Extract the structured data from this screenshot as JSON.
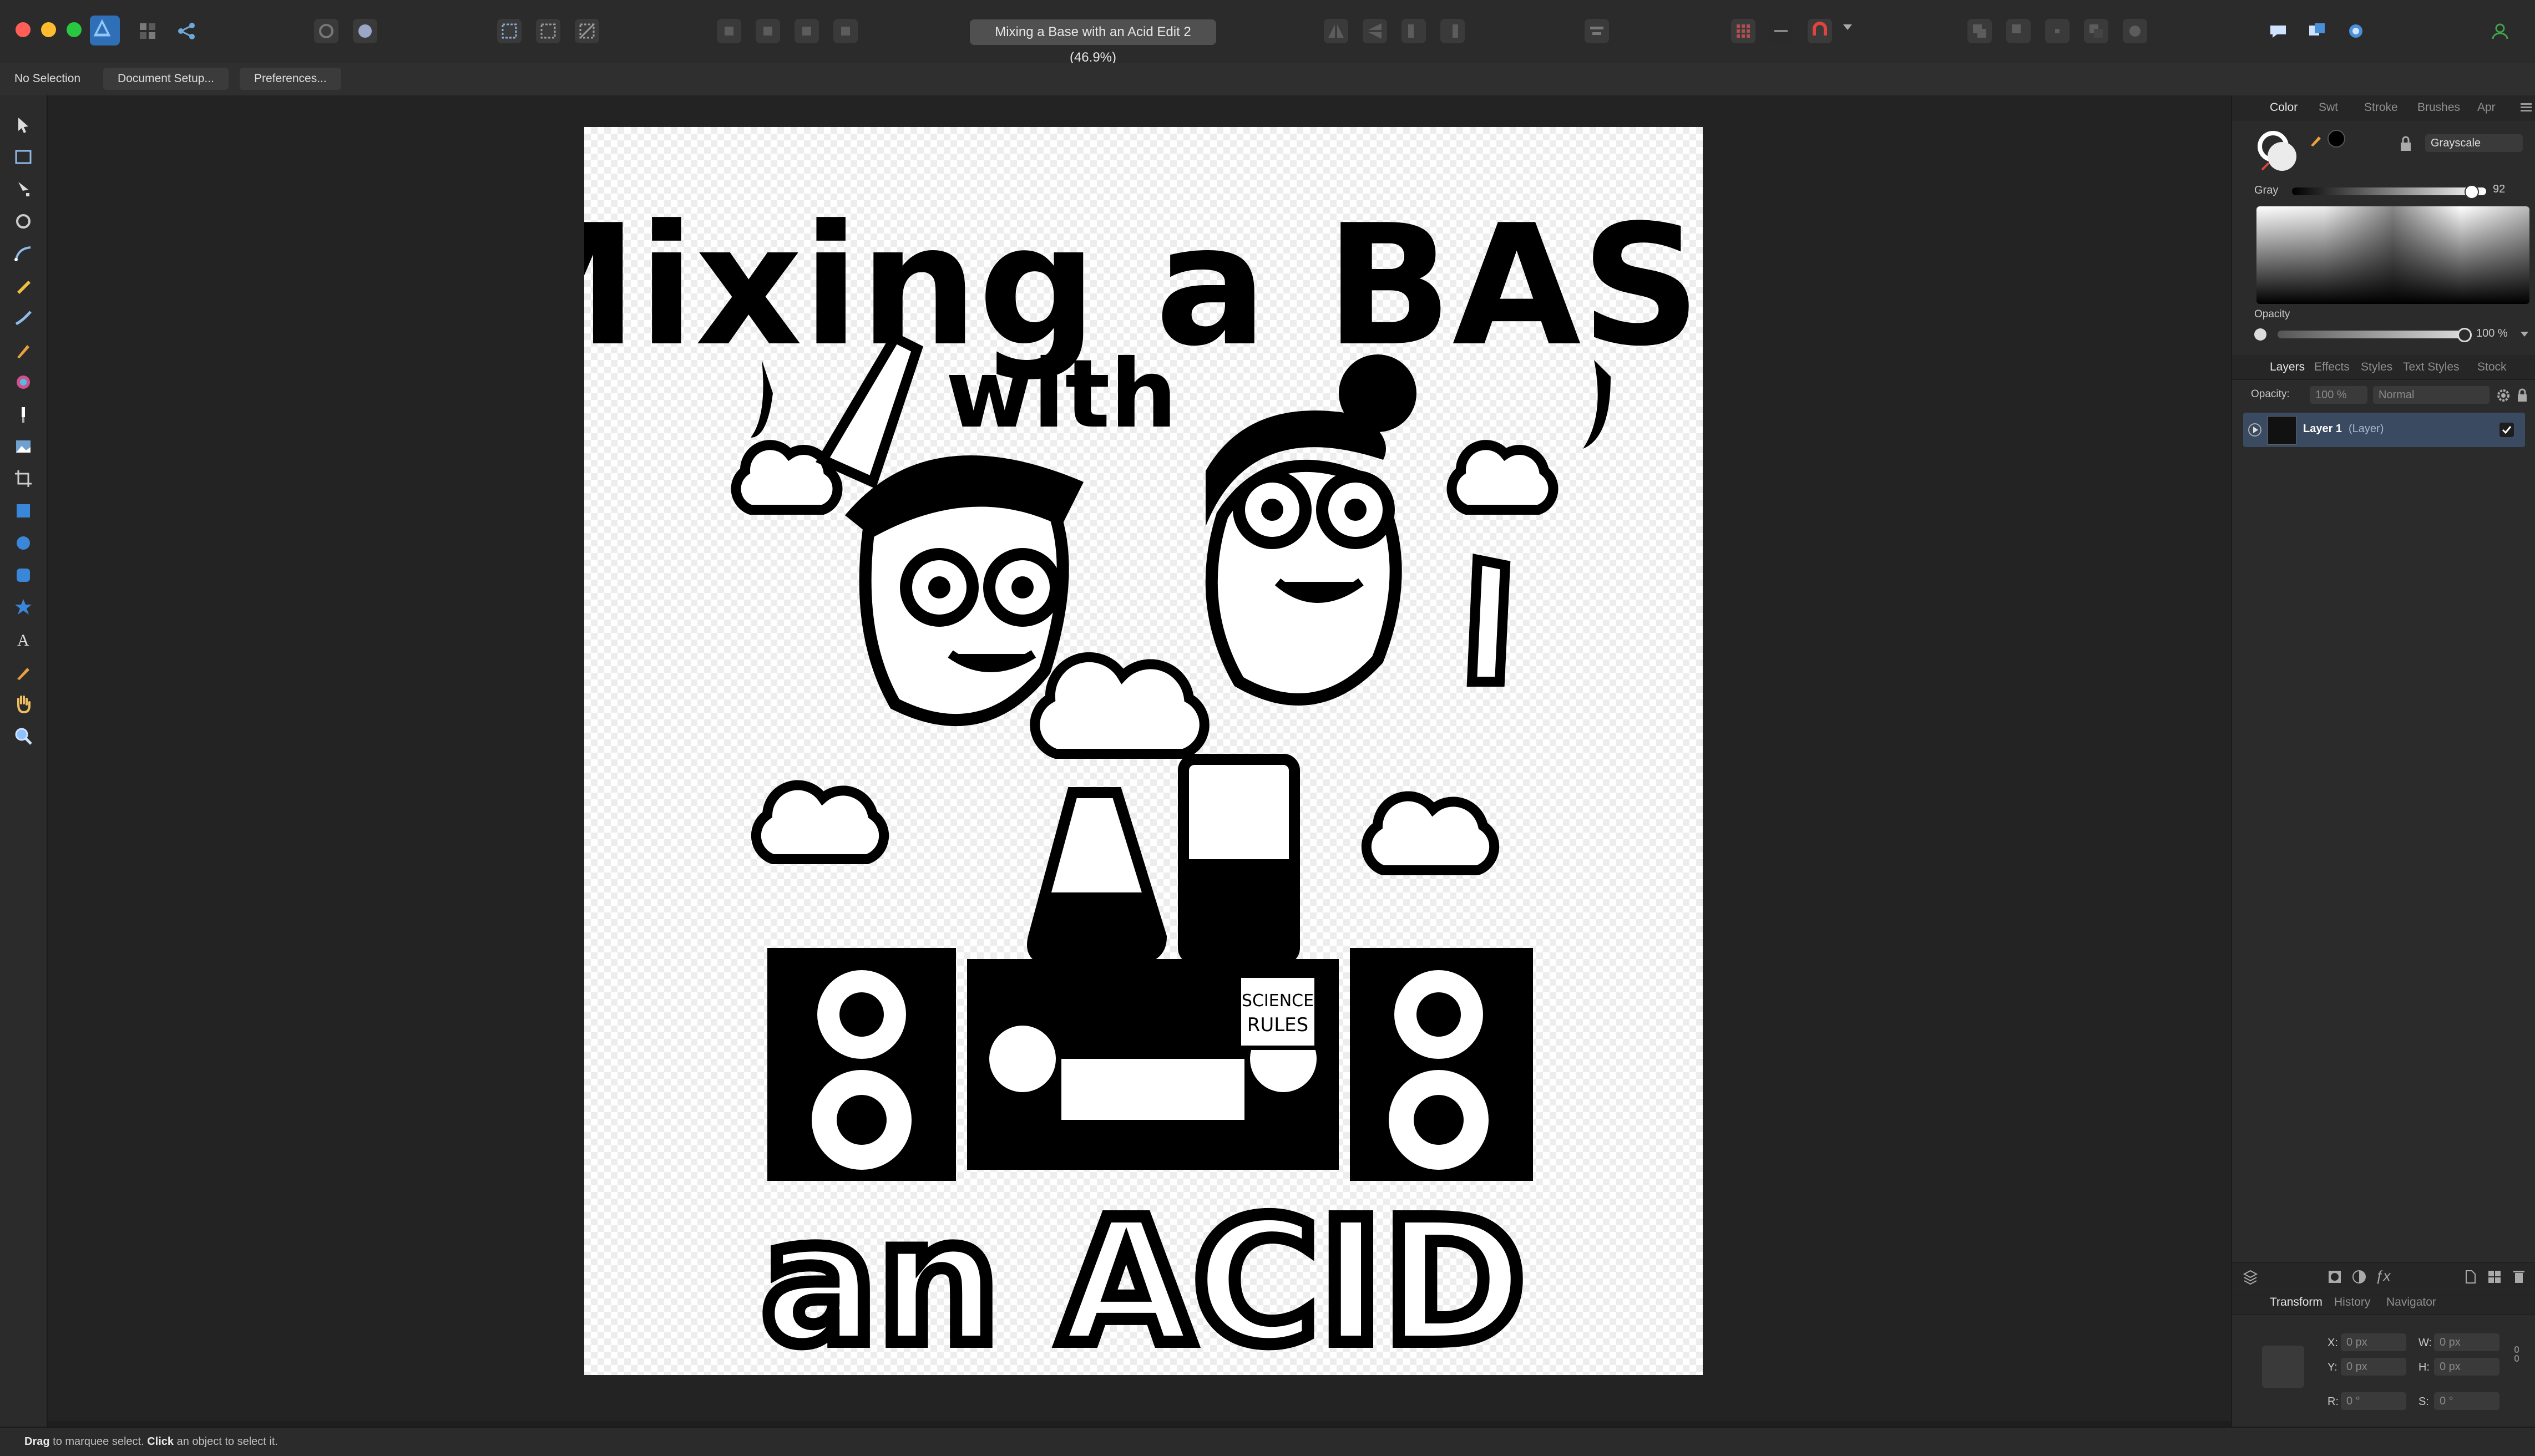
{
  "app": {
    "document_title": "Mixing a Base with an Acid Edit 2 (46.9%)"
  },
  "context_toolbar": {
    "selection_status": "No Selection",
    "document_setup_label": "Document Setup...",
    "preferences_label": "Preferences..."
  },
  "color_panel": {
    "tabs": [
      "Color",
      "Swt",
      "Stroke",
      "Brushes",
      "Apr"
    ],
    "model": "Grayscale",
    "gray_label": "Gray",
    "gray_value": "92",
    "gray_level": 0.92,
    "opacity_label": "Opacity",
    "opacity_value": "100 %"
  },
  "layers_panel": {
    "tabs": [
      "Layers",
      "Effects",
      "Styles",
      "Text Styles",
      "Stock"
    ],
    "opacity_label": "Opacity:",
    "opacity_value": "100 %",
    "blend_mode": "Normal",
    "layers": [
      {
        "name": "Layer 1",
        "type": "(Layer)",
        "visible": true
      }
    ]
  },
  "transform_panel": {
    "tabs": [
      "Transform",
      "History",
      "Navigator"
    ],
    "fields": [
      {
        "label": "X:",
        "value": "0 px"
      },
      {
        "label": "W:",
        "value": "0 px"
      },
      {
        "label": "Y:",
        "value": "0 px"
      },
      {
        "label": "H:",
        "value": "0 px"
      },
      {
        "label": "R:",
        "value": "0 °"
      },
      {
        "label": "S:",
        "value": "0 °"
      }
    ]
  },
  "status_bar": {
    "drag_word": "Drag",
    "drag_hint": " to marquee select. ",
    "click_word": "Click",
    "click_hint": " an object to select it."
  },
  "artwork": {
    "title_line_1": "Mixing a BASE",
    "title_line_2": "with",
    "bottom_text": "an ACID",
    "sign_text_1": "SCIENCE",
    "sign_text_2": "RULES"
  },
  "colors": {
    "accent_blue": "#4a90d9",
    "traffic_close": "#ff5f57",
    "traffic_minimize": "#febc2e",
    "traffic_zoom": "#28c840",
    "snapping_red": "#e0443e"
  },
  "icons": {
    "tools": [
      "move-tool",
      "artboard-tool",
      "node-tool",
      "corner-tool",
      "pen-tool",
      "pencil-tool",
      "vector-brush-tool",
      "paint-brush-tool",
      "fill-tool",
      "transparency-tool",
      "place-image-tool",
      "crop-tool",
      "rectangle-tool",
      "ellipse-tool",
      "rounded-rect-tool",
      "star-tool",
      "artistic-text-tool",
      "color-picker-tool",
      "hand-tool",
      "zoom-tool"
    ]
  }
}
